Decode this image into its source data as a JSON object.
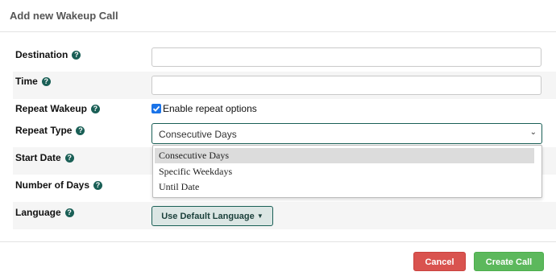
{
  "modal": {
    "title": "Add new Wakeup Call"
  },
  "form": {
    "destination": {
      "label": "Destination",
      "value": ""
    },
    "time": {
      "label": "Time",
      "value": ""
    },
    "repeat_wakeup": {
      "label": "Repeat Wakeup",
      "checkbox_label": "Enable repeat options",
      "checked": true
    },
    "repeat_type": {
      "label": "Repeat Type",
      "selected": "Consecutive Days",
      "options": [
        "Consecutive Days",
        "Specific Weekdays",
        "Until Date"
      ]
    },
    "start_date": {
      "label": "Start Date"
    },
    "number_of_days": {
      "label": "Number of Days"
    },
    "language": {
      "label": "Language",
      "button_label": "Use Default Language"
    }
  },
  "footer": {
    "cancel_label": "Cancel",
    "create_label": "Create Call"
  },
  "colors": {
    "accent": "#1a5f56",
    "cancel": "#d9534f",
    "create": "#5cb85c"
  },
  "icons": {
    "help": "question-circle-icon",
    "check": "check-icon",
    "select_arrow": "chevron-down-icon",
    "caret": "caret-down-icon"
  }
}
